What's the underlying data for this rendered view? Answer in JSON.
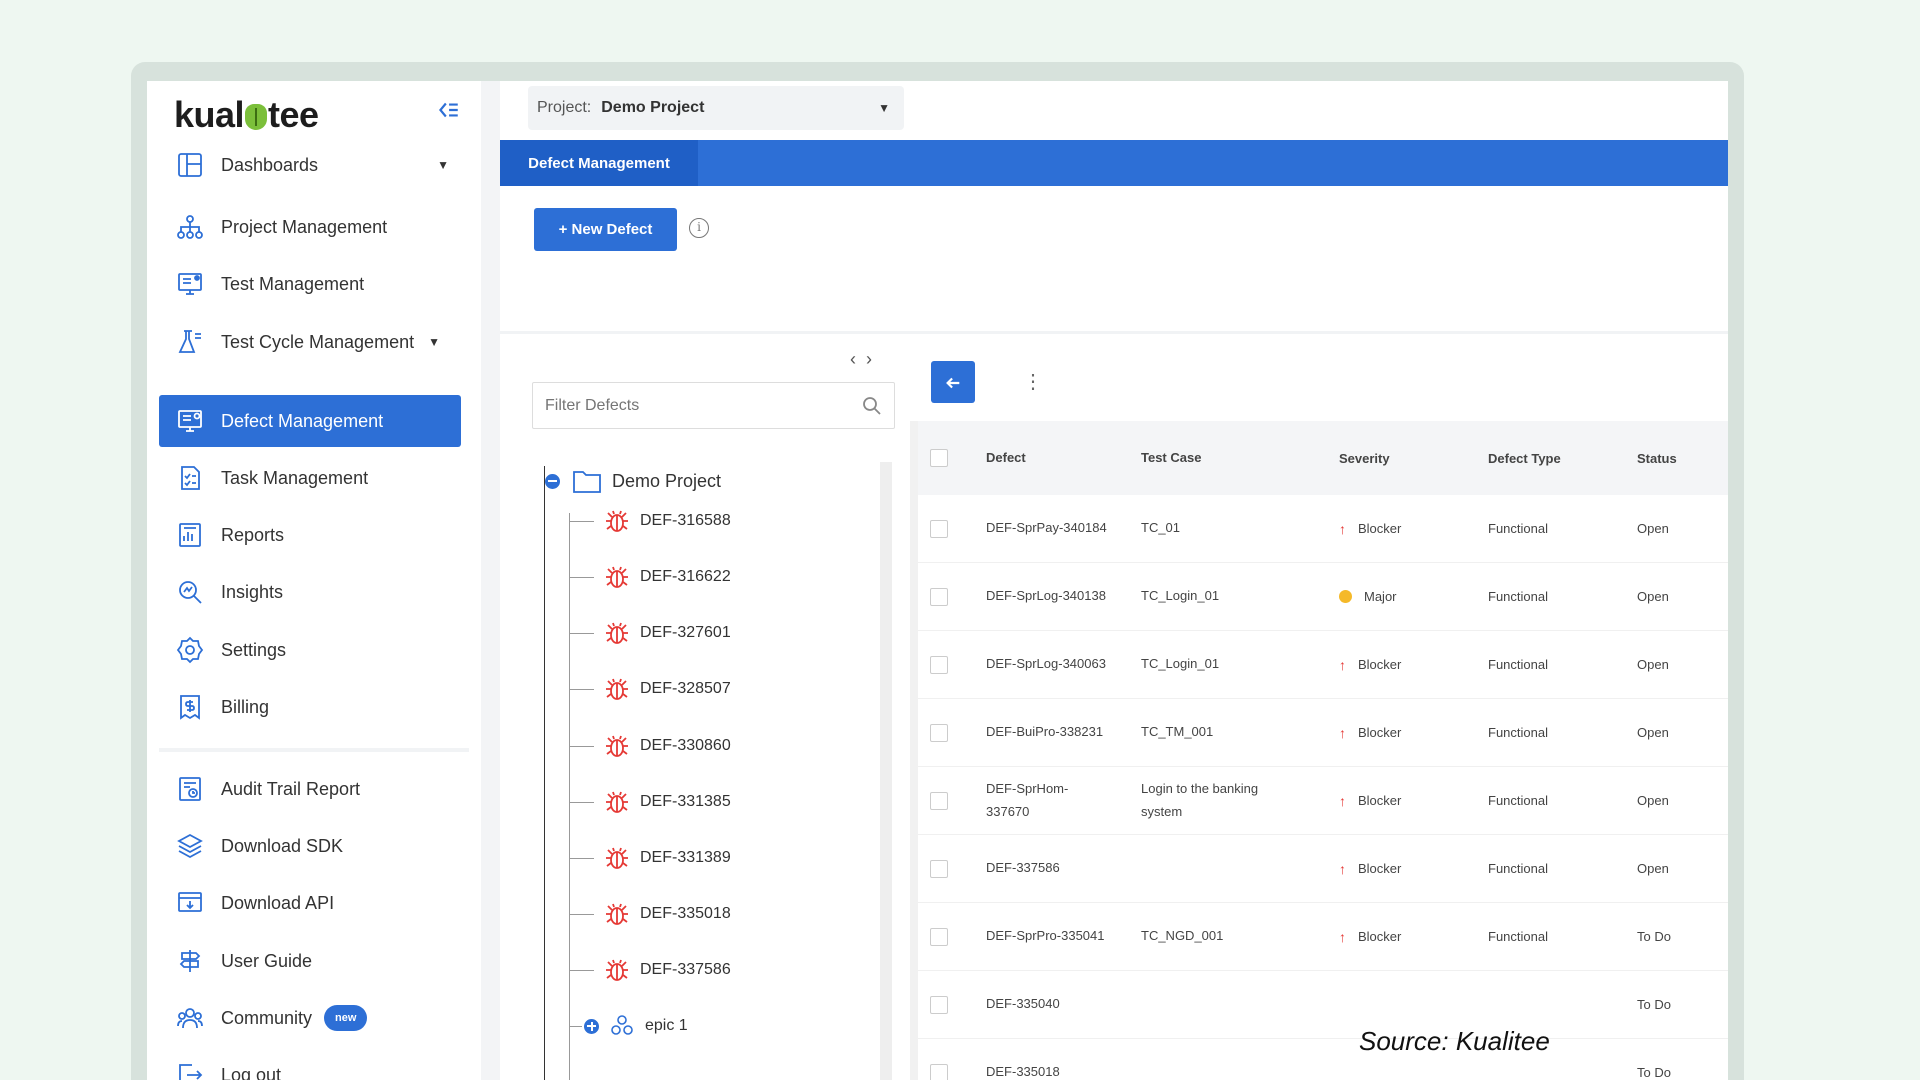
{
  "brand": {
    "logo_left": "kual",
    "logo_right": "tee"
  },
  "sidebar": {
    "items": [
      {
        "label": "Dashboards",
        "icon": "dashboard-icon",
        "caret": "▼"
      },
      {
        "label": "Project Management",
        "icon": "project-management-icon"
      },
      {
        "label": "Test Management",
        "icon": "test-management-icon"
      },
      {
        "label": "Test Cycle Management",
        "icon": "test-cycle-icon",
        "caret": "▼"
      },
      {
        "label": "Defect Management",
        "icon": "defect-management-icon",
        "active": true
      },
      {
        "label": "Task Management",
        "icon": "task-management-icon"
      },
      {
        "label": "Reports",
        "icon": "reports-icon"
      },
      {
        "label": "Insights",
        "icon": "insights-icon"
      },
      {
        "label": "Settings",
        "icon": "settings-icon"
      },
      {
        "label": "Billing",
        "icon": "billing-icon"
      },
      {
        "label": "Audit Trail Report",
        "icon": "audit-trail-icon"
      },
      {
        "label": "Download SDK",
        "icon": "download-sdk-icon"
      },
      {
        "label": "Download API",
        "icon": "download-api-icon"
      },
      {
        "label": "User Guide",
        "icon": "user-guide-icon"
      },
      {
        "label": "Community",
        "icon": "community-icon",
        "badge": "new"
      },
      {
        "label": "Log out",
        "icon": "logout-icon"
      }
    ]
  },
  "topbar": {
    "project_label": "Project:",
    "project_value": "Demo Project"
  },
  "tabs": [
    {
      "label": "Defect Management"
    }
  ],
  "toolbar": {
    "new_defect_label": "+ New Defect",
    "info_glyph": "i"
  },
  "tree": {
    "filter_placeholder": "Filter Defects",
    "root": "Demo Project",
    "items": [
      "DEF-316588",
      "DEF-316622",
      "DEF-327601",
      "DEF-328507",
      "DEF-330860",
      "DEF-331385",
      "DEF-331389",
      "DEF-335018",
      "DEF-337586"
    ],
    "epic": "epic 1"
  },
  "table": {
    "headers": {
      "defect": "Defect",
      "test_case": "Test Case",
      "severity": "Severity",
      "defect_type": "Defect Type",
      "status": "Status"
    },
    "rows": [
      {
        "defect": "DEF-SprPay-340184",
        "test_case": "TC_01",
        "severity": "Blocker",
        "defect_type": "Functional",
        "status": "Open"
      },
      {
        "defect": "DEF-SprLog-340138",
        "test_case": "TC_Login_01",
        "severity": "Major",
        "defect_type": "Functional",
        "status": "Open"
      },
      {
        "defect": "DEF-SprLog-340063",
        "test_case": "TC_Login_01",
        "severity": "Blocker",
        "defect_type": "Functional",
        "status": "Open"
      },
      {
        "defect": "DEF-BuiPro-338231",
        "test_case": "TC_TM_001",
        "severity": "Blocker",
        "defect_type": "Functional",
        "status": "Open"
      },
      {
        "defect": "DEF-SprHom-337670",
        "test_case": "Login to the banking system",
        "severity": "Blocker",
        "defect_type": "Functional",
        "status": "Open"
      },
      {
        "defect": "DEF-337586",
        "test_case": "",
        "severity": "Blocker",
        "defect_type": "Functional",
        "status": "Open"
      },
      {
        "defect": "DEF-SprPro-335041",
        "test_case": "TC_NGD_001",
        "severity": "Blocker",
        "defect_type": "Functional",
        "status": "To Do"
      },
      {
        "defect": "DEF-335040",
        "test_case": "",
        "severity": "",
        "defect_type": "",
        "status": "To Do"
      },
      {
        "defect": "DEF-335018",
        "test_case": "",
        "severity": "",
        "defect_type": "",
        "status": "To Do"
      }
    ]
  },
  "colors": {
    "primary": "#2d6fd6",
    "blocker": "#e53935",
    "major": "#f5b929",
    "background": "#eef7f1"
  },
  "source_credit": "Source: Kualitee"
}
